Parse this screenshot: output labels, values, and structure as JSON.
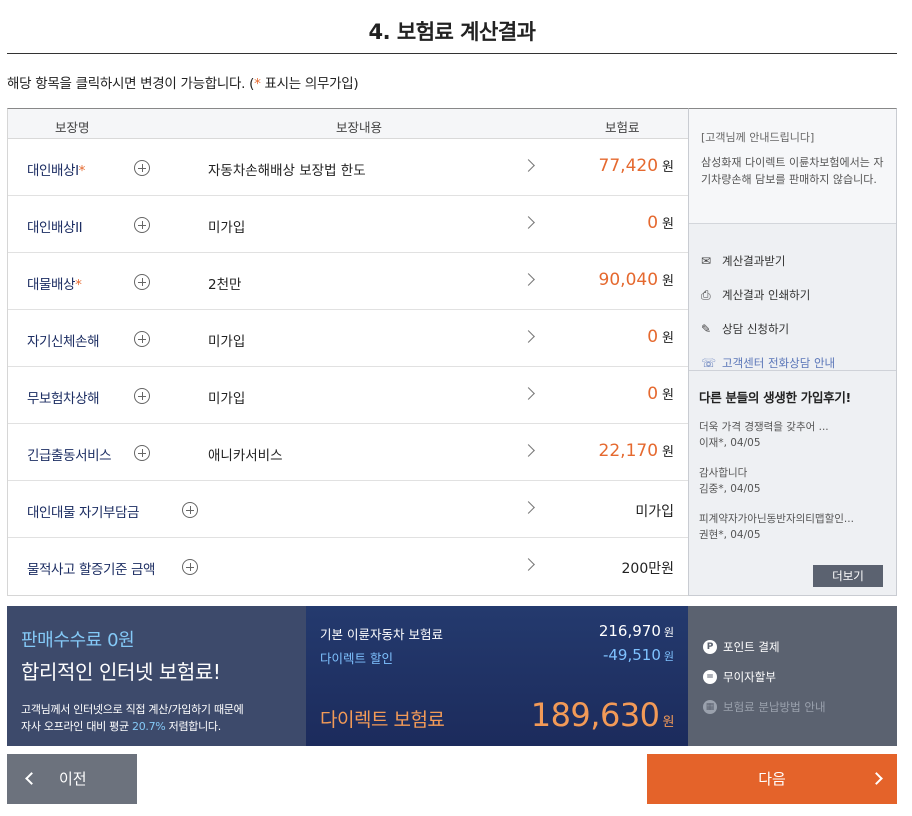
{
  "page": {
    "title": "4. 보험료 계산결과"
  },
  "notice": {
    "text": "해당 항목을 클릭하시면 변경이 가능합니다. (",
    "star": "*",
    "tail": " 표시는 의무가입)"
  },
  "table": {
    "headers": {
      "name": "보장명",
      "content": "보장내용",
      "premium": "보험료"
    },
    "rows": [
      {
        "name": "대인배상I",
        "star": "*",
        "desc": "자동차손해배상 보장법 한도",
        "amount": "77,420",
        "unit": "원"
      },
      {
        "name": "대인배상II",
        "star": "",
        "desc": "미가입",
        "amount": "0",
        "unit": "원"
      },
      {
        "name": "대물배상",
        "star": "*",
        "desc": "2천만",
        "amount": "90,040",
        "unit": "원"
      },
      {
        "name": "자기신체손해",
        "star": "",
        "desc": "미가입",
        "amount": "0",
        "unit": "원"
      },
      {
        "name": "무보험차상해",
        "star": "",
        "desc": "미가입",
        "amount": "0",
        "unit": "원"
      },
      {
        "name": "긴급출동서비스",
        "star": "",
        "desc": "애니카서비스",
        "amount": "22,170",
        "unit": "원"
      },
      {
        "name": "대인대물 자기부담금",
        "star": "",
        "desc": "",
        "value": "미가입"
      },
      {
        "name": "물적사고 할증기준 금액",
        "star": "",
        "desc": "",
        "value": "200만원"
      }
    ]
  },
  "side": {
    "info_head": "[고객님께 안내드립니다]",
    "info_body": "삼성화재 다이렉트 이륜차보험에서는 자기차량손해 담보를 판매하지 않습니다.",
    "links": [
      {
        "label": "계산결과받기",
        "icon": "mail-icon"
      },
      {
        "label": "계산결과 인쇄하기",
        "icon": "print-icon"
      },
      {
        "label": "상담 신청하기",
        "icon": "edit-icon"
      },
      {
        "label": "고객센터 전화상담 안내",
        "icon": "headset-icon"
      }
    ],
    "reviews_title": "다른 분들의 생생한 가입후기!",
    "reviews": [
      {
        "text": "더욱 가격 경쟁력을 갖추어 ...",
        "meta": "이재*, 04/05"
      },
      {
        "text": "감사합니다",
        "meta": "김중*, 04/05"
      },
      {
        "text": "피계약자가아닌동반자의티맵할인...",
        "meta": "권현*, 04/05"
      }
    ],
    "more": "더보기"
  },
  "promo": {
    "line1": "판매수수료 0원",
    "line2": "합리적인 인터넷 보험료!",
    "line3a": "고객님께서 인터넷으로 직접 계산/가입하기 때문에",
    "line3b": "자사 오프라인 대비 평균 ",
    "line3hl": "20.7%",
    "line3c": " 저렴합니다."
  },
  "summary": {
    "base_label": "기본 이륜자동차 보험료",
    "base_value": "216,970",
    "disc_label": "다이렉트 할인",
    "disc_value": "-49,510",
    "total_label": "다이렉트 보험료",
    "total_value": "189,630",
    "unit": "원"
  },
  "payment": [
    {
      "label": "포인트 결제",
      "icon": "P"
    },
    {
      "label": "무이자할부",
      "icon": "="
    },
    {
      "label": "보험료 분납방법 안내",
      "icon": "▦"
    }
  ],
  "nav": {
    "prev": "이전",
    "next": "다음"
  }
}
